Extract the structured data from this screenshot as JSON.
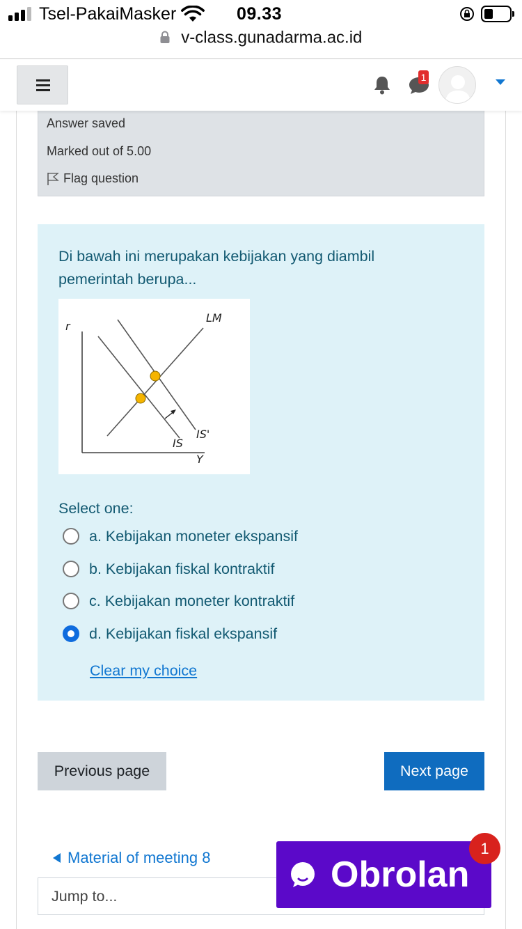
{
  "status_bar": {
    "carrier": "Tsel-PakaiMasker",
    "time": "09.33"
  },
  "browser": {
    "url": "v-class.gunadarma.ac.id"
  },
  "navbar": {
    "chat_badge": "1"
  },
  "question_info": {
    "state": "Answer saved",
    "grade": "Marked out of 5.00",
    "flag_label": "Flag question"
  },
  "question": {
    "text": "Di bawah ini merupakan kebijakan yang diambil pemerintah berupa...",
    "graph": {
      "y_axis_label": "r",
      "x_axis_label": "Y",
      "curve_lm": "LM",
      "curve_is": "IS",
      "curve_is_shift": "IS'"
    },
    "prompt": "Select one:",
    "options": [
      {
        "label": "a. Kebijakan moneter ekspansif",
        "selected": false
      },
      {
        "label": "b. Kebijakan fiskal kontraktif",
        "selected": false
      },
      {
        "label": "c. Kebijakan moneter kontraktif",
        "selected": false
      },
      {
        "label": "d. Kebijakan fiskal ekspansif",
        "selected": true
      }
    ],
    "clear_label": "Clear my choice"
  },
  "navigation": {
    "previous_label": "Previous page",
    "next_label": "Next page",
    "previous_activity": "Material of meeting 8",
    "jump_placeholder": "Jump to..."
  },
  "chat_widget": {
    "label": "Obrolan",
    "badge": "1"
  },
  "colors": {
    "question_bg": "#def2f8",
    "question_text": "#135a72",
    "primary": "#0f6cbf",
    "chat_widget": "#5b09c9",
    "badge": "#d8221d"
  }
}
